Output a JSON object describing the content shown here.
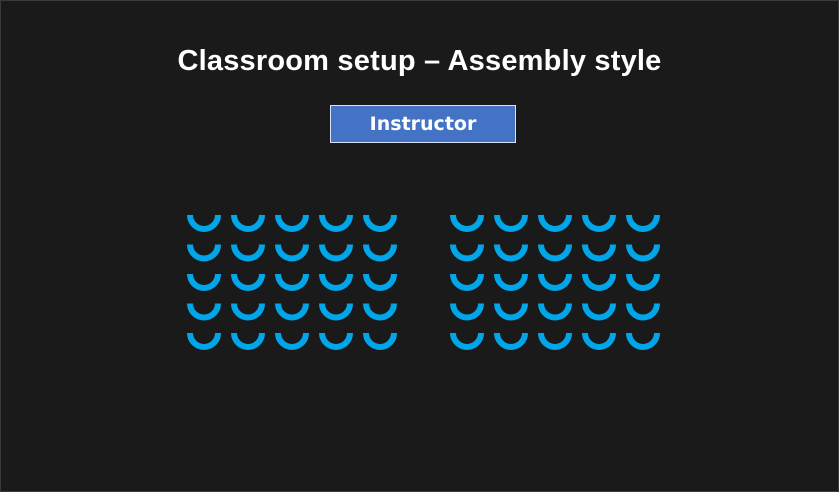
{
  "slide": {
    "title": "Classroom setup – Assembly style",
    "instructor_label": "Instructor"
  },
  "seating": {
    "sections": [
      {
        "rows": 5,
        "seats_per_row": 5
      },
      {
        "rows": 5,
        "seats_per_row": 5
      }
    ],
    "seat_icon": "seat-arc-icon",
    "seat_color": "#00a6e8"
  },
  "colors": {
    "background": "#1a1a1a",
    "instructor_fill": "#4472c4",
    "title": "#ffffff"
  }
}
